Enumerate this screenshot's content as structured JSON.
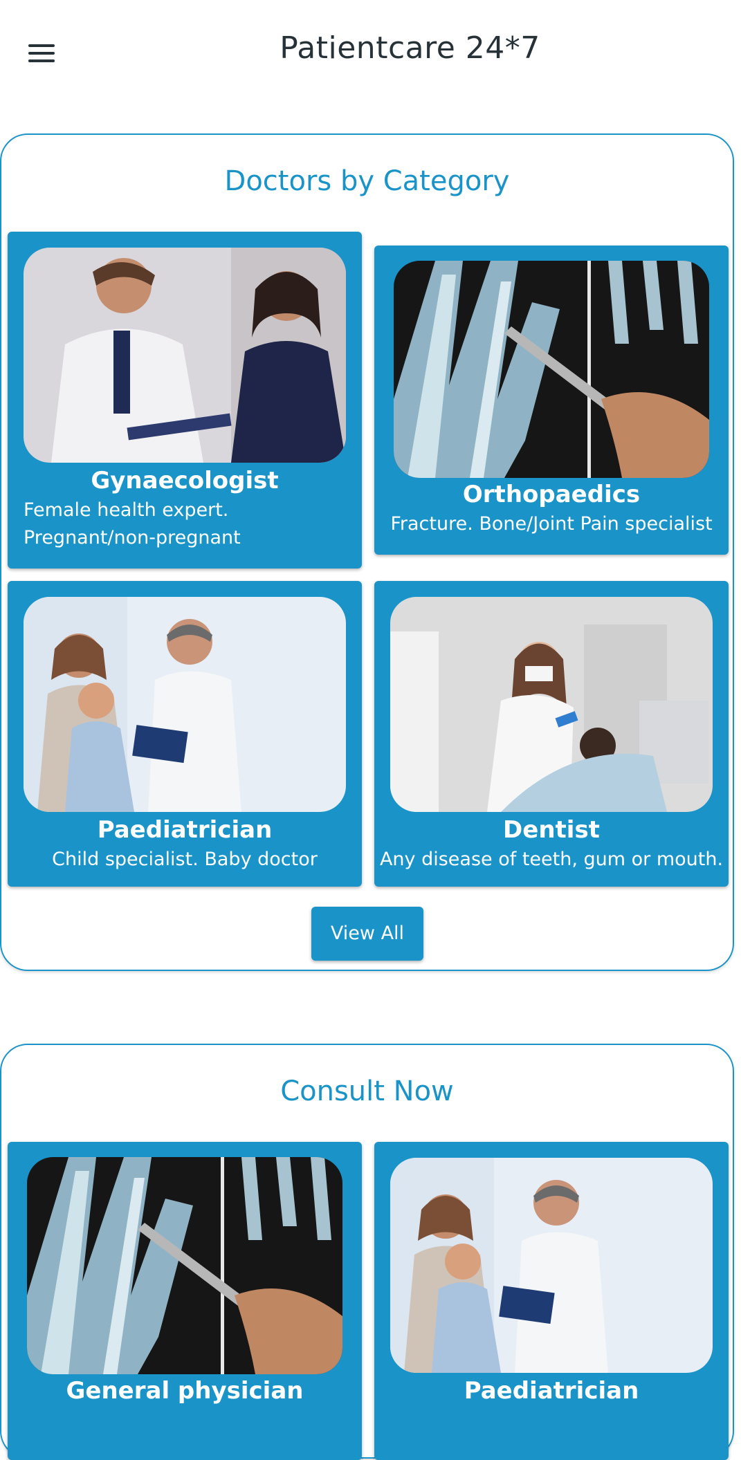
{
  "header": {
    "title": "Patientcare 24*7",
    "menu_icon": "hamburger-menu-icon"
  },
  "categories_section": {
    "title": "Doctors by Category",
    "cards": [
      {
        "name": "Gynaecologist",
        "description": "Female health expert. Pregnant/non-pregnant",
        "image": "doctor-with-pregnant-woman-photo"
      },
      {
        "name": "Orthopaedics",
        "description": "Fracture. Bone/Joint Pain specialist",
        "image": "hand-xray-photo"
      },
      {
        "name": "Paediatrician",
        "description": "Child specialist. Baby doctor",
        "image": "doctor-with-family-photo"
      },
      {
        "name": "Dentist",
        "description": "Any disease of teeth, gum or mouth.",
        "image": "dentist-with-patient-photo"
      }
    ],
    "view_all_label": "View All"
  },
  "consult_section": {
    "title": "Consult Now",
    "cards": [
      {
        "name": "General physician",
        "image": "hand-xray-photo"
      },
      {
        "name": "Paediatrician",
        "image": "doctor-with-family-photo"
      }
    ]
  },
  "colors": {
    "accent": "#1a94c8",
    "text": "#263238",
    "background": "#ffffff"
  }
}
